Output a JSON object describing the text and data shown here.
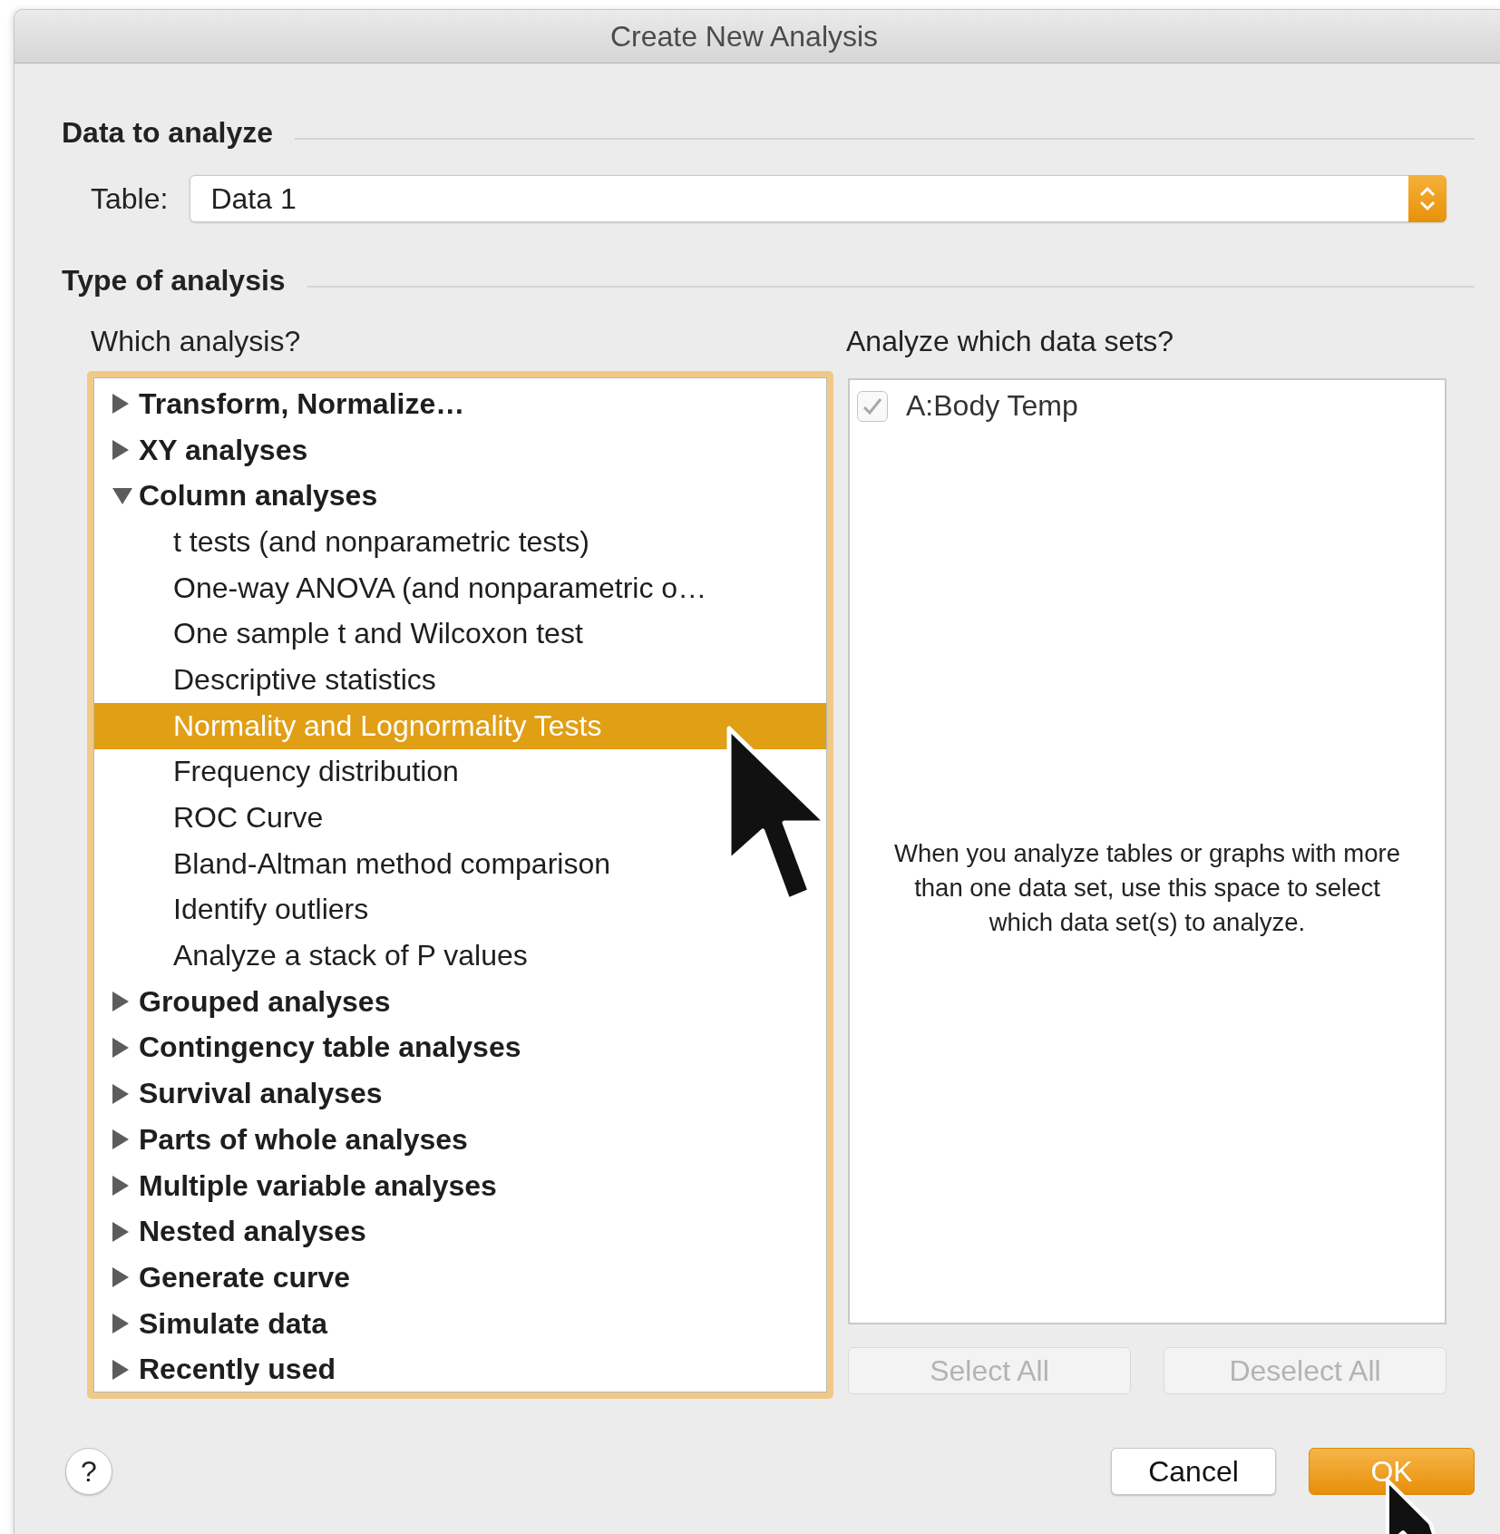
{
  "window": {
    "title": "Create New Analysis"
  },
  "data_to_analyze": {
    "heading": "Data to analyze",
    "table_label": "Table:",
    "table_select": {
      "value": "Data 1"
    }
  },
  "type_of_analysis": {
    "heading": "Type of analysis",
    "which_label": "Which analysis?",
    "data_sets_label": "Analyze which data sets?"
  },
  "analyses": [
    {
      "label": "Transform, Normalize…",
      "expanded": false,
      "selected": false
    },
    {
      "label": "XY analyses",
      "expanded": false,
      "selected": false
    },
    {
      "label": "Column analyses",
      "expanded": true,
      "selected": false,
      "children": [
        {
          "label": "t tests (and nonparametric tests)",
          "selected": false
        },
        {
          "label": "One-way ANOVA (and nonparametric o…",
          "selected": false
        },
        {
          "label": "One sample t and Wilcoxon test",
          "selected": false
        },
        {
          "label": "Descriptive statistics",
          "selected": false
        },
        {
          "label": "Normality and Lognormality Tests",
          "selected": true
        },
        {
          "label": "Frequency distribution",
          "selected": false
        },
        {
          "label": "ROC Curve",
          "selected": false
        },
        {
          "label": "Bland-Altman method comparison",
          "selected": false
        },
        {
          "label": "Identify outliers",
          "selected": false
        },
        {
          "label": "Analyze a stack of P values",
          "selected": false
        }
      ]
    },
    {
      "label": "Grouped analyses",
      "expanded": false,
      "selected": false
    },
    {
      "label": "Contingency table analyses",
      "expanded": false,
      "selected": false
    },
    {
      "label": "Survival analyses",
      "expanded": false,
      "selected": false
    },
    {
      "label": "Parts of whole analyses",
      "expanded": false,
      "selected": false
    },
    {
      "label": "Multiple variable analyses",
      "expanded": false,
      "selected": false
    },
    {
      "label": "Nested analyses",
      "expanded": false,
      "selected": false
    },
    {
      "label": "Generate curve",
      "expanded": false,
      "selected": false
    },
    {
      "label": "Simulate data",
      "expanded": false,
      "selected": false
    },
    {
      "label": "Recently used",
      "expanded": false,
      "selected": false
    }
  ],
  "data_sets": [
    {
      "label": "A:Body Temp",
      "checked": true,
      "disabled": true
    }
  ],
  "data_sets_hint": "When you analyze tables or graphs with more than one data set, use this space to select which data set(s) to analyze.",
  "data_set_buttons": [
    {
      "label": "Select All",
      "disabled": true
    },
    {
      "label": "Deselect All",
      "disabled": true
    }
  ],
  "help_button": "?",
  "buttons": [
    {
      "label": "Cancel",
      "kind": "normal"
    },
    {
      "label": "OK",
      "kind": "default"
    }
  ]
}
